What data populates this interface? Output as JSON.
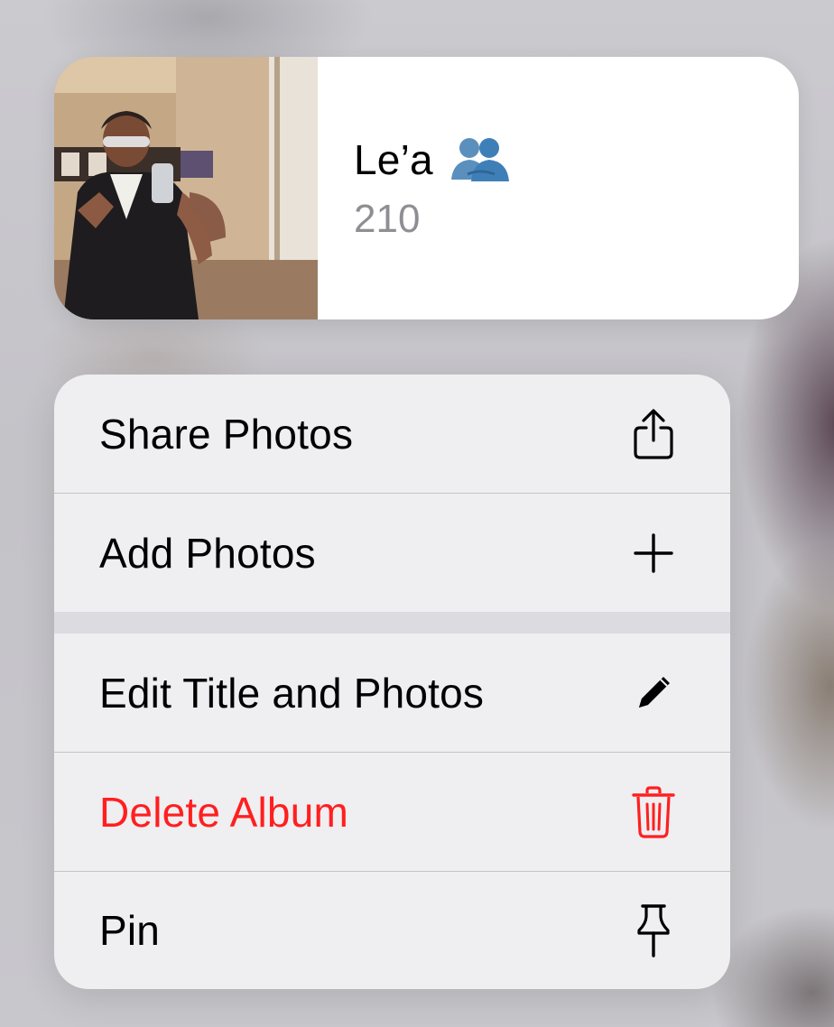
{
  "album": {
    "name": "Le’a",
    "count": "210",
    "shared_icon": "people-icon"
  },
  "menu": {
    "items": [
      {
        "label": "Share Photos",
        "icon": "share-icon",
        "destructive": false
      },
      {
        "label": "Add Photos",
        "icon": "plus-icon",
        "destructive": false
      },
      {
        "label": "Edit Title and Photos",
        "icon": "pencil-icon",
        "destructive": false
      },
      {
        "label": "Delete Album",
        "icon": "trash-icon",
        "destructive": true
      },
      {
        "label": "Pin",
        "icon": "pin-icon",
        "destructive": false
      }
    ]
  },
  "colors": {
    "destructive": "#ff1f1f",
    "secondary_text": "#8e8e93",
    "shared_icon": "#3f7fb8"
  }
}
